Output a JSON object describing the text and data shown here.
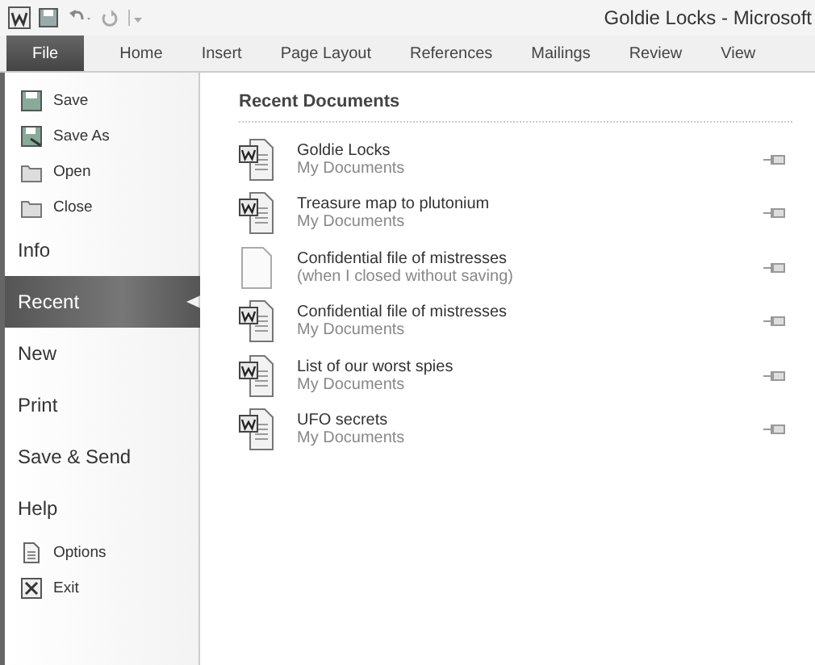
{
  "window": {
    "title": "Goldie Locks - Microsoft"
  },
  "tabs": [
    {
      "label": "File",
      "selected": true
    },
    {
      "label": "Home",
      "selected": false
    },
    {
      "label": "Insert",
      "selected": false
    },
    {
      "label": "Page Layout",
      "selected": false
    },
    {
      "label": "References",
      "selected": false
    },
    {
      "label": "Mailings",
      "selected": false
    },
    {
      "label": "Review",
      "selected": false
    },
    {
      "label": "View",
      "selected": false
    }
  ],
  "sidebar": {
    "items": [
      {
        "label": "Save",
        "kind": "command",
        "selected": false
      },
      {
        "label": "Save As",
        "kind": "command",
        "selected": false
      },
      {
        "label": "Open",
        "kind": "command",
        "selected": false
      },
      {
        "label": "Close",
        "kind": "command",
        "selected": false
      },
      {
        "label": "Info",
        "kind": "section",
        "selected": false
      },
      {
        "label": "Recent",
        "kind": "section",
        "selected": true
      },
      {
        "label": "New",
        "kind": "section",
        "selected": false
      },
      {
        "label": "Print",
        "kind": "section",
        "selected": false
      },
      {
        "label": "Save & Send",
        "kind": "section",
        "selected": false
      },
      {
        "label": "Help",
        "kind": "section",
        "selected": false
      },
      {
        "label": "Options",
        "kind": "command",
        "selected": false
      },
      {
        "label": "Exit",
        "kind": "command",
        "selected": false
      }
    ]
  },
  "recent": {
    "heading": "Recent Documents",
    "documents": [
      {
        "name": "Goldie Locks",
        "location": "My Documents",
        "kind": "word"
      },
      {
        "name": "Treasure map to plutonium",
        "location": "My Documents",
        "kind": "word"
      },
      {
        "name": "Confidential file of mistresses",
        "location": "(when I closed without saving)",
        "kind": "blank"
      },
      {
        "name": "Confidential file of mistresses",
        "location": "My Documents",
        "kind": "word"
      },
      {
        "name": "List of our worst spies",
        "location": "My Documents",
        "kind": "word"
      },
      {
        "name": "UFO secrets",
        "location": "My Documents",
        "kind": "word"
      }
    ]
  }
}
